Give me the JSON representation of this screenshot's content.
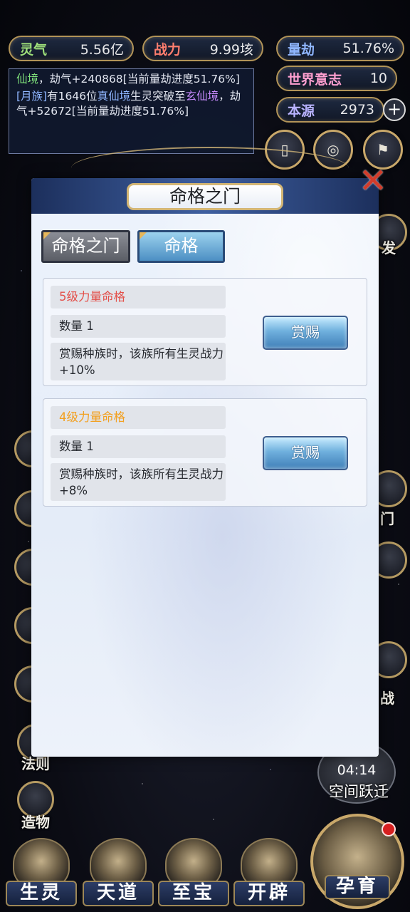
{
  "hud": {
    "lingqi": {
      "label": "灵气",
      "value": "5.56亿"
    },
    "zhanli": {
      "label": "战力",
      "value": "9.99垓"
    },
    "liangjie": {
      "label": "量劫",
      "value": "51.76%"
    },
    "shijie": {
      "label": "世界意志",
      "value": "10"
    },
    "benyuan": {
      "label": "本源",
      "value": "2973"
    }
  },
  "log": {
    "p1a": "仙境",
    "p1b": "，劫气+240868[当前量劫进度51.76%]",
    "p2a": "[月族]",
    "p2b": "有1646位",
    "p2c": "真仙境",
    "p2d": "生灵突破至",
    "p2e": "玄仙境",
    "p2f": "，劫气+52672[当前量劫进度51.76%]"
  },
  "side": {
    "fa": "发",
    "men": "门",
    "zhan": "战",
    "faze": "法则",
    "zaowu": "造物"
  },
  "timer": {
    "time": "04:14",
    "label": "空间跃迁"
  },
  "nav": {
    "shengling": "生灵",
    "tiandao": "天道",
    "zhibao": "至宝",
    "kaipi": "开辟",
    "yunyu": "孕育"
  },
  "modal": {
    "title": "命格之门",
    "tabs": {
      "gate": "命格之门",
      "fate": "命格"
    },
    "cards": [
      {
        "name": "5级力量命格",
        "qty": "数量   1",
        "desc": "赏赐种族时，该族所有生灵战力+10%",
        "button": "赏赐"
      },
      {
        "name": "4级力量命格",
        "qty": "数量   1",
        "desc": "赏赐种族时，该族所有生灵战力+8%",
        "button": "赏赐"
      }
    ]
  },
  "colors": {
    "accent_gold": "#c9a86a",
    "tab_active": "#4c8fc3",
    "name_lv5": "#e3504a",
    "name_lv4": "#f2a020"
  }
}
